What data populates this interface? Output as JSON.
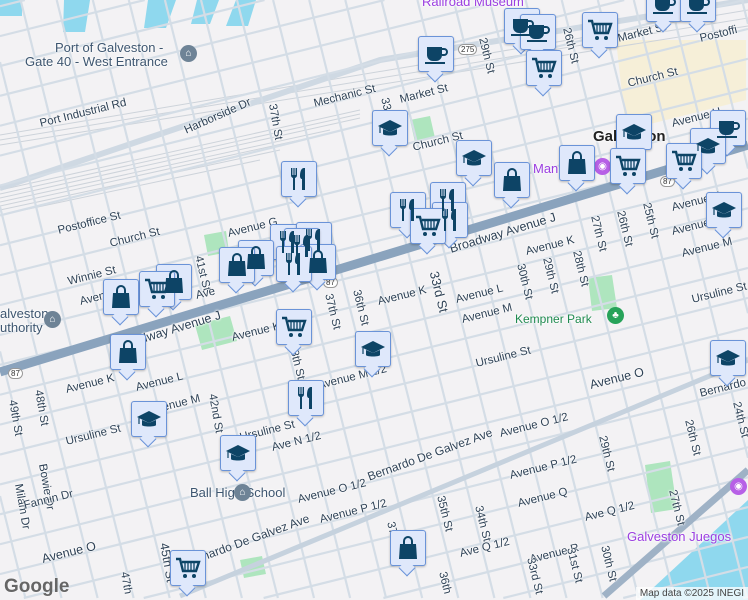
{
  "map": {
    "places": {
      "port": [
        "Port of Galveston -",
        "Gate 40 - West Entrance"
      ],
      "railroad_museum": "Railroad Museum",
      "city": "Galveston",
      "mangos": "Man",
      "kempner_park": "Kempner Park",
      "ball_high": "Ball High School",
      "juegos": "Galveston Juegos",
      "authority": [
        "alveston",
        "uthority"
      ]
    },
    "streets": [
      "Port Industrial Rd",
      "Harborside Dr",
      "37th St",
      "Mechanic St",
      "Market St",
      "33rd St",
      "Church St",
      "29th St",
      "26th St",
      "Market St",
      "Church St",
      "Postoffi",
      "Avenue H",
      "Postoffice St",
      "Church St",
      "Avenue G",
      "Winnie St",
      "41st St",
      "Ave",
      "Aven",
      "Broadway Avenue J",
      "Broadway Avenue J",
      "Avenue K",
      "38th St",
      "37th St",
      "36th St",
      "Avenue K",
      "33rd St",
      "Avenue L",
      "30th St",
      "29th St",
      "28th St",
      "27th St",
      "26th St",
      "25th St",
      "Avenue K",
      "Avenue L",
      "Avenue M",
      "Avenue K",
      "Avenue M",
      "Ursuline St",
      "Ursuline St",
      "Avenue O",
      "Bernardo",
      "24th St",
      "48th St",
      "49th St",
      "Avenue K",
      "Avenue L",
      "Avenue M",
      "42nd St",
      "Ursuline St",
      "Ave N 1/2",
      "Avenue M 1/2",
      "Bowie Dr",
      "Milam Dr",
      "Fannin Dr",
      "Avenue O 1/2",
      "Bernardo De Galvez Ave",
      "Avenue O 1/2",
      "29th St",
      "26th St",
      "Avenue P 1/2",
      "Avenue Q",
      "Ave Q 1/2",
      "27th St",
      "35th St",
      "34th St",
      "Avenue O",
      "45th St",
      "Bernardo De Galvez Ave",
      "Avenue P 1/2",
      "37th St",
      "Ave Q 1/2",
      "Avenue R",
      "31st St",
      "30th St",
      "33rd St",
      "47th",
      "36th",
      "Ursuline St"
    ],
    "highway_shields": [
      "275",
      "87",
      "87",
      "87"
    ],
    "attribution": "Map data ©2025 INEGI",
    "logo": "Google",
    "colors": {
      "marker_bg": "#dfe8fb",
      "marker_border": "#6a93d8",
      "icon": "#0d4466",
      "water": "#8fd8ee",
      "park": "#aee5be",
      "highway": "#8aa3bd"
    }
  }
}
